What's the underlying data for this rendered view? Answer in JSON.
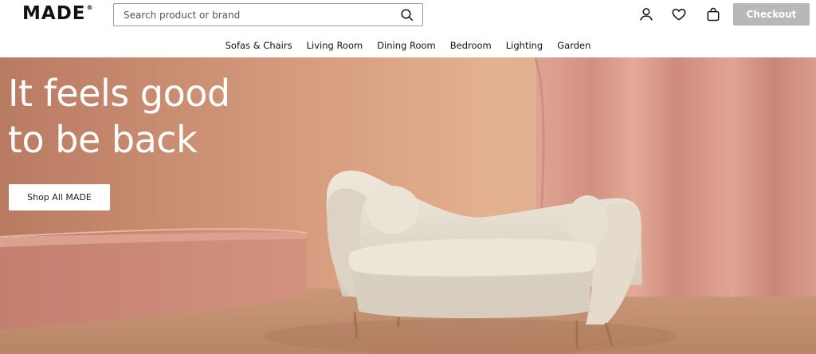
{
  "header": {
    "logo": "MADE",
    "logo_mark": "®",
    "search_placeholder": "Search product or brand",
    "checkout_label": "Checkout",
    "icons": [
      "search-icon",
      "account-icon",
      "heart-icon",
      "bag-icon"
    ]
  },
  "nav": {
    "items": [
      "Sofas & Chairs",
      "Living Room",
      "Dining Room",
      "Bedroom",
      "Lighting",
      "Garden"
    ]
  },
  "hero": {
    "title_line1": "It feels good",
    "title_line2": "to be back",
    "cta_label": "Shop All MADE"
  },
  "colors": {
    "checkout_bg": "#b8b8b8",
    "hero_wall": "#d9a88b",
    "curtain": "#d99a8c",
    "sofa": "#e8e0d2"
  }
}
